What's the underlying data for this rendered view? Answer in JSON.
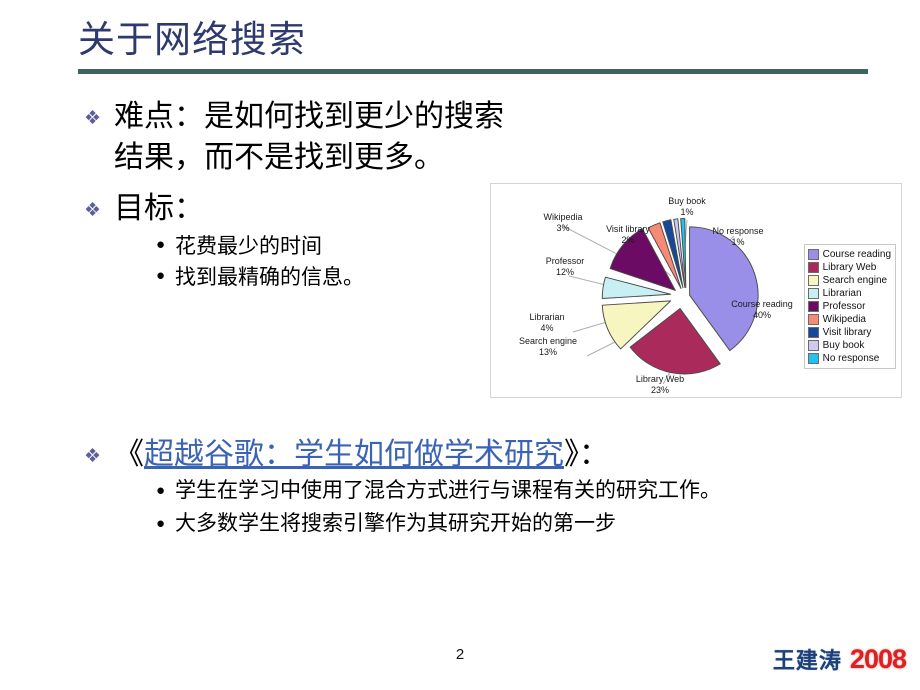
{
  "slide": {
    "title": "关于网络搜索",
    "page_number": "2",
    "rule_color": "#3c6460",
    "title_color": "#2e3a6e"
  },
  "bullets": {
    "marker_lvl1": "❖",
    "marker_lvl2": "●",
    "difficulty": {
      "label": "难点：是如何找到更少的搜索结果，而不是找到更多。"
    },
    "goal": {
      "label": "目标：",
      "items": [
        "花费最少的时间",
        "找到最精确的信息。"
      ]
    },
    "book": {
      "open_quote": "《",
      "link_text": "超越谷歌：学生如何做学术研究",
      "close_quote": "》",
      "colon": "：",
      "link_color": "#3b63b5",
      "items": [
        "学生在学习中使用了混合方式进行与课程有关的研究工作。",
        "大多数学生将搜索引擎作为其研究开始的第一步"
      ]
    }
  },
  "chart_data": {
    "type": "pie",
    "title": "",
    "exploded": true,
    "legend_position": "right",
    "categories": [
      "Course reading",
      "Library Web",
      "Search engine",
      "Librarian",
      "Professor",
      "Wikipedia",
      "Visit library",
      "Buy book",
      "No response"
    ],
    "values": [
      40,
      23,
      13,
      4,
      12,
      3,
      2,
      1,
      1
    ],
    "value_labels": [
      "40%",
      "23%",
      "13%",
      "4%",
      "12%",
      "3%",
      "2%",
      "1%",
      "1%"
    ],
    "colors": [
      "#9a8fe8",
      "#ab2a5c",
      "#f7f5c0",
      "#c8f0f4",
      "#6b0b63",
      "#f78a75",
      "#15479a",
      "#cfc8ef",
      "#1fc4ee"
    ],
    "callouts": [
      {
        "name": "Wikipedia",
        "pct": "3%"
      },
      {
        "name": "Visit library",
        "pct": "2%"
      },
      {
        "name": "Buy book",
        "pct": "1%"
      },
      {
        "name": "No response",
        "pct": "1%"
      },
      {
        "name": "Professor",
        "pct": "12%"
      },
      {
        "name": "Course reading",
        "pct": "40%"
      },
      {
        "name": "Librarian",
        "pct": "4%"
      },
      {
        "name": "Search engine",
        "pct": "13%"
      },
      {
        "name": "Library Web",
        "pct": "23%"
      }
    ]
  },
  "footer": {
    "brand_name": "王建涛",
    "brand_year": "2008",
    "brand_name_color": "#1d3f7a",
    "brand_year_color": "#e02020"
  }
}
